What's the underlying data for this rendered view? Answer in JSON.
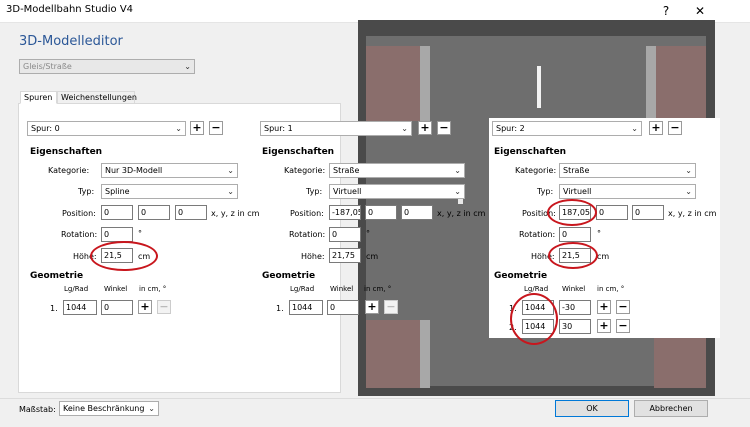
{
  "window": {
    "title": "3D-Modellbahn Studio V4",
    "help": "?",
    "close": "✕"
  },
  "editor": {
    "heading": "3D-Modelleditor",
    "type_combo": "Gleis/Straße"
  },
  "tabs": [
    {
      "label": "Spuren"
    },
    {
      "label": "Weichenstellungen"
    }
  ],
  "labels": {
    "eigenschaften": "Eigenschaften",
    "kategorie": "Kategorie:",
    "typ": "Typ:",
    "position": "Position:",
    "rotation": "Rotation:",
    "hoehe": "Höhe:",
    "geometrie": "Geometrie",
    "lg_rad": "Lg/Rad",
    "winkel": "Winkel",
    "in_cm": "in cm, °",
    "xyz": "x, y, z in cm",
    "deg": "°",
    "cm": "cm",
    "plus": "+",
    "minus": "−"
  },
  "spuren": [
    {
      "spur": "Spur: 0",
      "kategorie": "Nur 3D-Modell",
      "typ": "Spline",
      "position": [
        "0",
        "0",
        "0"
      ],
      "rotation": "0",
      "hoehe": "21,5",
      "geometrie": [
        {
          "index": "1.",
          "lg": "1044",
          "winkel": "0"
        }
      ]
    },
    {
      "spur": "Spur: 1",
      "kategorie": "Straße",
      "typ": "Virtuell",
      "position": [
        "-187,05",
        "0",
        "0"
      ],
      "rotation": "0",
      "hoehe": "21,75",
      "geometrie": [
        {
          "index": "1.",
          "lg": "1044",
          "winkel": "0"
        }
      ]
    },
    {
      "spur": "Spur: 2",
      "kategorie": "Straße",
      "typ": "Virtuell",
      "position": [
        "187,05",
        "0",
        "0"
      ],
      "rotation": "0",
      "hoehe": "21,5",
      "geometrie": [
        {
          "index": "1.",
          "lg": "1044",
          "winkel": "-30"
        },
        {
          "index": "2.",
          "lg": "1044",
          "winkel": "30"
        }
      ]
    }
  ],
  "footer": {
    "massstab_label": "Maßstab:",
    "massstab_value": "Keine Beschränkung",
    "ok": "OK",
    "cancel": "Abbrechen"
  },
  "colors": {
    "accent": "#2b5797",
    "highlight": "#c8161d",
    "ok_border": "#0078d7"
  }
}
